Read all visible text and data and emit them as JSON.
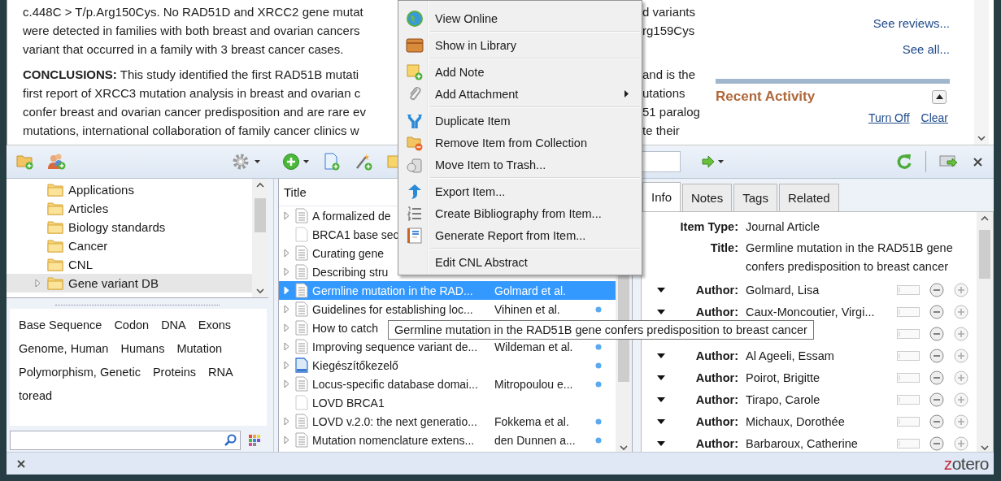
{
  "web_page": {
    "abstract": [
      {
        "lines": [
          {
            "left": "c.448C > T/p.Arg150Cys. No RAD51D and XRCC2 gene mutat",
            "right": "d variants"
          },
          {
            "left": "were detected in families with both breast and ovarian cancers",
            "right": "rg159Cys"
          },
          {
            "left": "variant that occurred in a family with 3 breast cancer cases."
          }
        ]
      },
      {
        "lines": [
          {
            "left": "**CONCLUSIONS:** This study identified the first RAD51B mutati",
            "right": "and is the"
          },
          {
            "left": "first report of XRCC3 mutation analysis in breast and ovarian c",
            "right": "utations"
          },
          {
            "left": "confer breast and ovarian cancer predisposition and are rare ev",
            "right": "51 paralog"
          },
          {
            "left": "mutations, international collaboration of family cancer clinics w",
            "right": "te their"
          }
        ]
      }
    ],
    "side_links": [
      "See reviews...",
      "See all..."
    ],
    "recent_activity": {
      "title": "Recent Activity",
      "expanded": true,
      "links": [
        "Turn Off",
        "Clear"
      ]
    }
  },
  "collections": [
    {
      "name": "Applications",
      "expandable": false,
      "selected": false
    },
    {
      "name": "Articles",
      "expandable": false,
      "selected": false
    },
    {
      "name": "Biology standards",
      "expandable": false,
      "selected": false
    },
    {
      "name": "Cancer",
      "expandable": false,
      "selected": false
    },
    {
      "name": "CNL",
      "expandable": false,
      "selected": false
    },
    {
      "name": "Gene variant DB",
      "expandable": true,
      "selected": true
    }
  ],
  "tags": [
    "Base Sequence",
    "Codon",
    "DNA",
    "Exons",
    "Genome, Human",
    "Humans",
    "Mutation",
    "Polymorphism, Genetic",
    "Proteins",
    "RNA",
    "toread"
  ],
  "items": {
    "columns": [
      "Title"
    ],
    "rows": [
      {
        "title": "A formalized de",
        "kind": "document",
        "has_children": true,
        "attachment": false,
        "selected": false
      },
      {
        "title": "BRCA1 base sec",
        "kind": "blank",
        "has_children": false,
        "attachment": false,
        "selected": false
      },
      {
        "title": "Curating gene",
        "kind": "document",
        "has_children": true,
        "attachment": false,
        "selected": false
      },
      {
        "title": "Describing stru",
        "kind": "document",
        "has_children": true,
        "attachment": false,
        "selected": false
      },
      {
        "title": "Germline mutation in the RAD...",
        "creator": "Golmard et al.",
        "kind": "document",
        "has_children": true,
        "attachment": false,
        "selected": true
      },
      {
        "title": "Guidelines for establishing loc...",
        "creator": "Vihinen et al.",
        "kind": "document",
        "has_children": true,
        "attachment": true,
        "selected": false
      },
      {
        "title": "How to catch",
        "kind": "document",
        "has_children": true,
        "attachment": false,
        "selected": false
      },
      {
        "title": "Improving sequence variant de...",
        "creator": "Wildeman et al.",
        "kind": "document",
        "has_children": true,
        "attachment": true,
        "selected": false
      },
      {
        "title": "Kiegészítőkezelő",
        "kind": "webpage",
        "has_children": true,
        "attachment": true,
        "selected": false
      },
      {
        "title": "Locus-specific database domai...",
        "creator": "Mitropoulou e...",
        "kind": "document",
        "has_children": true,
        "attachment": true,
        "selected": false
      },
      {
        "title": "LOVD BRCA1",
        "kind": "blank",
        "has_children": false,
        "attachment": false,
        "selected": false
      },
      {
        "title": "LOVD v.2.0: the next generatio...",
        "creator": "Fokkema et al.",
        "kind": "document",
        "has_children": true,
        "attachment": true,
        "selected": false
      },
      {
        "title": "Mutation nomenclature extens...",
        "creator": "den Dunnen a...",
        "kind": "document",
        "has_children": true,
        "attachment": true,
        "selected": false
      }
    ]
  },
  "context_menu": {
    "groups": [
      [
        {
          "label": "View Online",
          "kind": "globe",
          "submenu": false
        }
      ],
      [
        {
          "label": "Show in Library",
          "kind": "library",
          "submenu": false
        }
      ],
      [
        {
          "label": "Add Note",
          "kind": "note",
          "submenu": false
        },
        {
          "label": "Add Attachment",
          "kind": "attachment",
          "submenu": true
        }
      ],
      [
        {
          "label": "Duplicate Item",
          "kind": "duplicate",
          "submenu": false
        },
        {
          "label": "Remove Item from Collection",
          "kind": "remove",
          "submenu": false
        },
        {
          "label": "Move Item to Trash...",
          "kind": "trash",
          "submenu": false
        }
      ],
      [
        {
          "label": "Export Item...",
          "kind": "export",
          "submenu": false
        },
        {
          "label": "Create Bibliography from Item...",
          "kind": "bibliography",
          "submenu": false
        },
        {
          "label": "Generate Report from Item...",
          "kind": "report",
          "submenu": false
        }
      ],
      [
        {
          "label": "Edit CNL Abstract",
          "kind": "plain",
          "submenu": false
        }
      ]
    ]
  },
  "tooltip": "Germline mutation in the RAD51B gene confers predisposition to breast cancer",
  "item_pane": {
    "tabs": [
      {
        "label": "Info",
        "selected": true
      },
      {
        "label": "Notes",
        "selected": false
      },
      {
        "label": "Tags",
        "selected": false
      },
      {
        "label": "Related",
        "selected": false
      }
    ],
    "fields": [
      {
        "label": "Item Type:",
        "value": "Journal Article"
      },
      {
        "label": "Title:",
        "value": "Germline mutation in the RAD51B gene confers predisposition to breast cancer"
      }
    ],
    "creators": [
      {
        "kind": "author",
        "label": "Author:",
        "name": "Golmard, Lisa"
      },
      {
        "kind": "author",
        "label": "Author:",
        "name": "Caux-Moncoutier, Virgi..."
      },
      {
        "kind": "covered"
      },
      {
        "kind": "author",
        "label": "Author:",
        "name": "Al Ageeli, Essam"
      },
      {
        "kind": "author",
        "label": "Author:",
        "name": "Poirot, Brigitte"
      },
      {
        "kind": "author",
        "label": "Author:",
        "name": "Tirapo, Carole"
      },
      {
        "kind": "author",
        "label": "Author:",
        "name": "Michaux, Dorothée"
      },
      {
        "kind": "author",
        "label": "Author:",
        "name": "Barbaroux, Catherine"
      }
    ]
  },
  "status_bar": {
    "logo": "zotero"
  }
}
